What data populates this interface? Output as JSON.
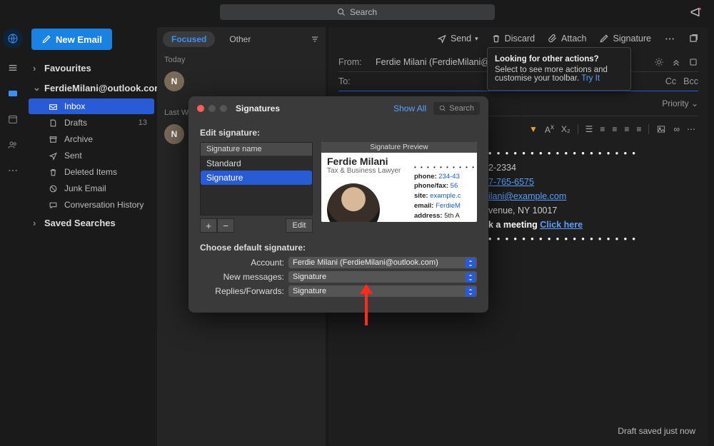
{
  "search_placeholder": "Search",
  "new_email": "New Email",
  "nav": {
    "favourites": "Favourites",
    "account": "FerdieMilani@outlook.com",
    "inbox": "Inbox",
    "drafts": "Drafts",
    "drafts_count": "13",
    "archive": "Archive",
    "sent": "Sent",
    "deleted": "Deleted Items",
    "junk": "Junk Email",
    "conv": "Conversation History",
    "saved": "Saved Searches"
  },
  "msglist": {
    "focused": "Focused",
    "other": "Other",
    "today": "Today",
    "lastweek": "Last W",
    "avatar1": "N",
    "avatar2": "N"
  },
  "compose": {
    "send": "Send",
    "discard": "Discard",
    "attach": "Attach",
    "signature": "Signature",
    "from_label": "From:",
    "from_value": "Ferdie Milani (FerdieMilani@outlo",
    "to_label": "To:",
    "cc": "Cc",
    "bcc": "Bcc",
    "priority": "Priority",
    "sig_phone_lbl": "2-2334",
    "sig_fax_lbl": "7-765-6575",
    "sig_email": "ilani@example.com",
    "sig_addr": "venue, NY 10017",
    "sig_book": "k a meeting",
    "sig_click": "Click here",
    "status": "Draft saved just now"
  },
  "popover": {
    "title": "Looking for other actions?",
    "body": "Select to see more actions and customise your toolbar. ",
    "try": "Try It"
  },
  "dialog": {
    "title": "Signatures",
    "showall": "Show All",
    "search": "Search",
    "edit_sig": "Edit signature:",
    "name_hdr": "Signature name",
    "name1": "Standard",
    "name2": "Signature",
    "edit": "Edit",
    "preview_hdr": "Signature Preview",
    "pv_name": "Ferdie Milani",
    "pv_role": "Tax & Business Lawyer",
    "pv_phone_l": "phone:",
    "pv_phone_v": "234-43",
    "pv_fax_l": "phone/fax:",
    "pv_fax_v": "56",
    "pv_site_l": "site:",
    "pv_site_v": "example.c",
    "pv_email_l": "email:",
    "pv_email_v": "FerdieM",
    "pv_addr_l": "address:",
    "pv_addr_v": "5th A",
    "choose": "Choose default signature:",
    "account_l": "Account:",
    "account_v": "Ferdie Milani (FerdieMilani@outlook.com)",
    "newmsg_l": "New messages:",
    "newmsg_v": "Signature",
    "reply_l": "Replies/Forwards:",
    "reply_v": "Signature"
  }
}
